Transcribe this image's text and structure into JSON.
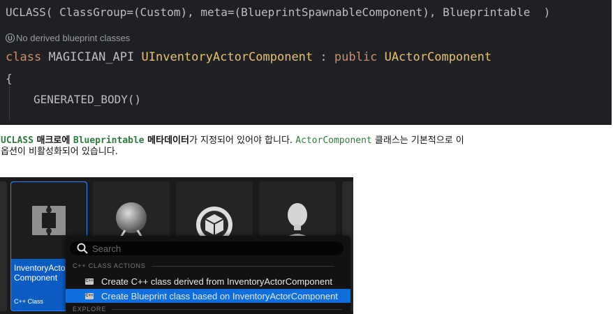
{
  "code": {
    "line1": "UCLASS( ClassGroup=(Custom), meta=(BlueprintSpawnableComponent), Blueprintable  )",
    "hint_badge": "U",
    "hint_text": "No derived blueprint classes",
    "kw_class": "class",
    "api_macro": "MAGICIAN_API",
    "class_name": "UInventoryActorComponent",
    "colon": ":",
    "kw_public": "public",
    "base_class": "UActorComponent",
    "brace": "{",
    "generated_body": "GENERATED_BODY()"
  },
  "paragraph": {
    "uclass": "UCLASS",
    "t1": " 매크로에 ",
    "blueprintable": "Blueprintable",
    "t2": " 메타데이터",
    "t3": "가 지정되어 있어야 합니다. ",
    "actor_component": "ActorComponent",
    "t4": " 클래스는 기본적으로 이",
    "t5": "옵션이 비활성화되어 있습니다."
  },
  "browser": {
    "selected_tile": {
      "name_line1": "InventoryActo",
      "name_line2": "Component",
      "type": "C++ Class"
    },
    "search_placeholder": "Search",
    "section_cpp": "C++ CLASS ACTIONS",
    "item_create_cpp": "Create C++ class derived from InventoryActorComponent",
    "item_create_bp": "Create Blueprint class based on InventoryActorComponent",
    "section_explore": "EXPLORE"
  },
  "colors": {
    "editor_bg": "#1f2024",
    "keyword": "#cf8e6d",
    "class_name": "#e9c16b",
    "highlight": "#0e6fdc",
    "selected_tile": "#0b5cc2"
  }
}
